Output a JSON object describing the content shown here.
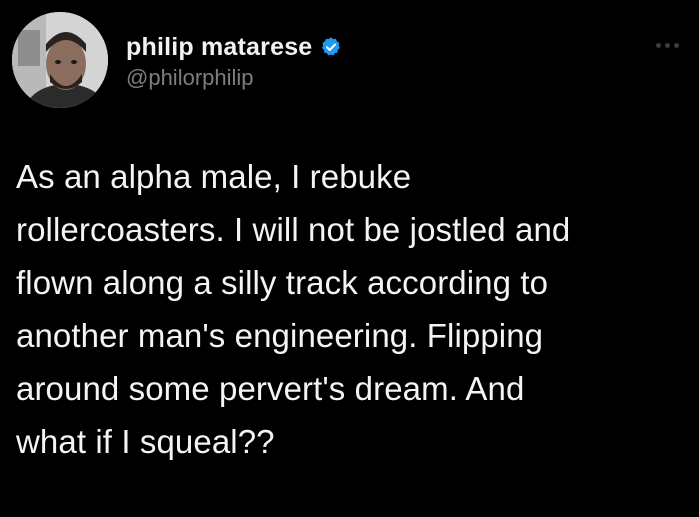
{
  "tweet": {
    "author": {
      "display_name": "philip matarese",
      "handle": "@philorphilip",
      "avatar_icon": "user-avatar",
      "verified_icon": "verified-badge-icon",
      "verified_color": "#1d9bf0"
    },
    "text": "As an alpha male, I rebuke\nrollercoasters. I will not be jostled and\nflown along a silly track according to\nanother man's engineering. Flipping\naround some pervert's dream. And\nwhat if I squeal??",
    "more_icon": "more-options-icon"
  },
  "colors": {
    "background": "#000000",
    "name_text": "#f2f2f2",
    "handle_text": "#7a7f84",
    "body_text": "#f4f4f4"
  }
}
